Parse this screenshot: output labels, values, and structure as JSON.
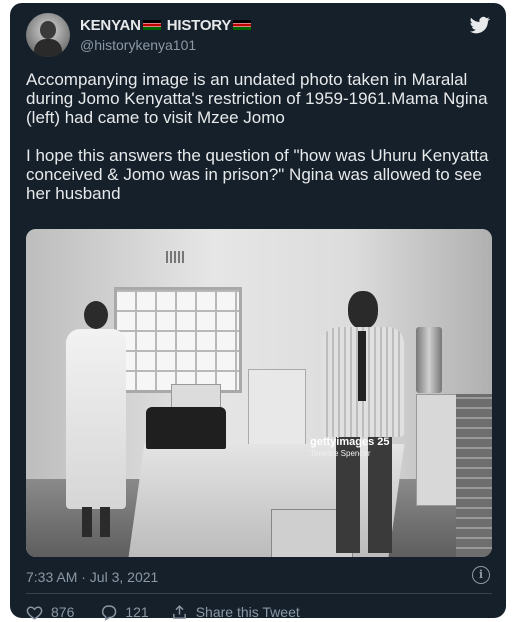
{
  "tweet": {
    "display_name_part1": "KENYAN",
    "display_name_part2": "HISTORY",
    "handle": "@historykenya101",
    "paragraph1": "Accompanying image is an undated photo taken in Maralal during Jomo Kenyatta's restriction of 1959-1961.Mama Ngina (left) had came to visit Mzee Jomo",
    "paragraph2": "I hope this answers the question of \"how was Uhuru Kenyatta conceived & Jomo was in prison?\" Ngina was allowed to see her husband",
    "timestamp": "7:33 AM · Jul 3, 2021",
    "info_glyph": "i"
  },
  "photo": {
    "watermark": "gettyimages",
    "watermark_number": "25",
    "credit": "Terence Spencer"
  },
  "actions": {
    "like_count": "876",
    "reply_count": "121",
    "share_label": "Share this Tweet"
  },
  "colors": {
    "background": "#15202b",
    "text": "#e7e9ea",
    "secondary": "#8b98a5",
    "divider": "#38444d"
  },
  "icons": [
    "twitter-bird-icon",
    "kenya-flag-icon",
    "info-icon",
    "heart-icon",
    "reply-icon",
    "share-icon"
  ]
}
